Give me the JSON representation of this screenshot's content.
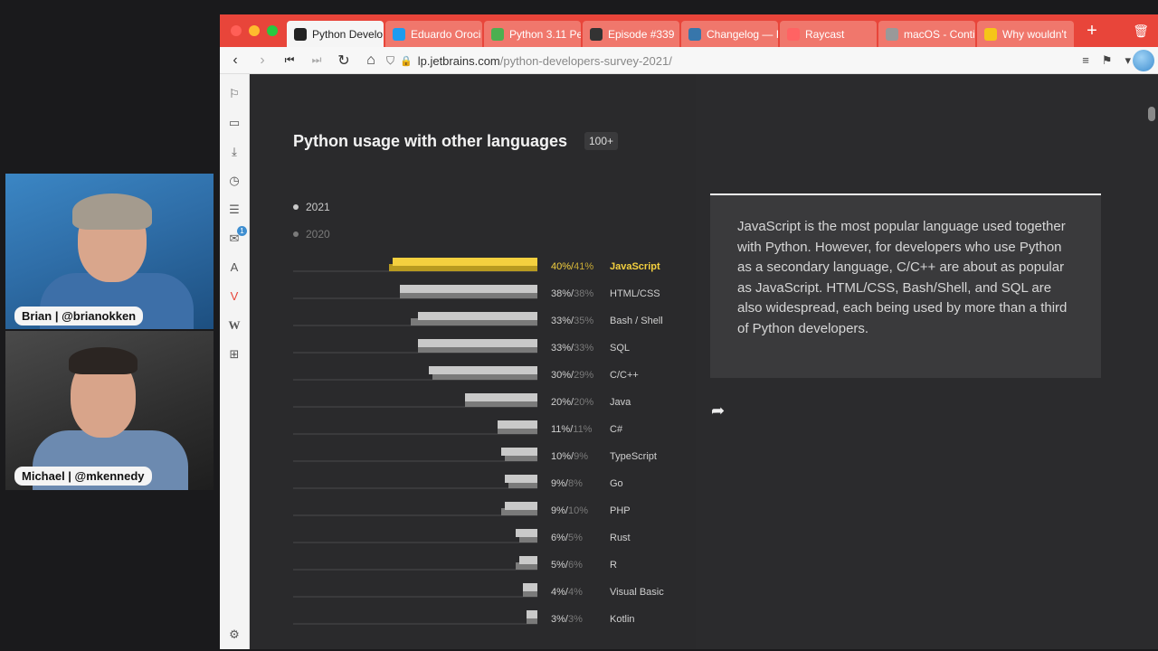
{
  "video": {
    "participant1": "Brian | @brianokken",
    "participant2": "Michael | @mkennedy"
  },
  "browser": {
    "tabs": [
      {
        "label": "Python Develo",
        "icon": "jetbrains-icon",
        "color": "#222222"
      },
      {
        "label": "Eduardo Oroci",
        "icon": "twitter-icon",
        "color": "#1d9bf0"
      },
      {
        "label": "Python 3.11 Pe",
        "icon": "discuss-icon",
        "color": "#4caf50"
      },
      {
        "label": "Episode #339",
        "icon": "podcast-icon",
        "color": "#333333"
      },
      {
        "label": "Changelog — I",
        "icon": "python-icon",
        "color": "#3776ab"
      },
      {
        "label": "Raycast",
        "icon": "raycast-icon",
        "color": "#ff6363"
      },
      {
        "label": "macOS - Conti",
        "icon": "apple-icon",
        "color": "#999999"
      },
      {
        "label": "Why wouldn't",
        "icon": "emoji-icon",
        "color": "#f5c518"
      }
    ],
    "url_host": "lp.jetbrains.com",
    "url_path": "/python-developers-survey-2021/",
    "sidebar_badge": "1"
  },
  "page": {
    "title": "Python usage with other languages",
    "badge": "100+",
    "legend_2021": "2021",
    "legend_2020": "2020",
    "color_2021": "#c9c9c9",
    "color_2020": "#7a7a7a",
    "accent": "#f4d03f",
    "description": "JavaScript is the most popular language used together with Python. However, for developers who use Python as a secondary language, C/C++ are about as popular as JavaScript. HTML/CSS, Bash/Shell, and SQL are also widespread, each being used by more than a third of Python developers."
  },
  "chart_data": {
    "type": "bar",
    "orientation": "horizontal",
    "title": "Python usage with other languages",
    "categories": [
      "JavaScript",
      "HTML/CSS",
      "Bash / Shell",
      "SQL",
      "C/C++",
      "Java",
      "C#",
      "TypeScript",
      "Go",
      "PHP",
      "Rust",
      "R",
      "Visual Basic",
      "Kotlin"
    ],
    "labels_2021": [
      "40%",
      "38%",
      "33%",
      "33%",
      "30%",
      "20%",
      "11%",
      "10%",
      "9%",
      "9%",
      "6%",
      "5%",
      "4%",
      "3%"
    ],
    "labels_2020": [
      "41%",
      "38%",
      "35%",
      "33%",
      "29%",
      "20%",
      "11%",
      "9%",
      "8%",
      "10%",
      "5%",
      "6%",
      "4%",
      "3%"
    ],
    "series": [
      {
        "name": "2021",
        "values": [
          40,
          38,
          33,
          33,
          30,
          20,
          11,
          10,
          9,
          9,
          6,
          5,
          4,
          3
        ]
      },
      {
        "name": "2020",
        "values": [
          41,
          38,
          35,
          33,
          29,
          20,
          11,
          9,
          8,
          10,
          5,
          6,
          4,
          3
        ]
      }
    ],
    "highlight": "JavaScript",
    "xlim": [
      0,
      100
    ],
    "legend": "top-left"
  }
}
